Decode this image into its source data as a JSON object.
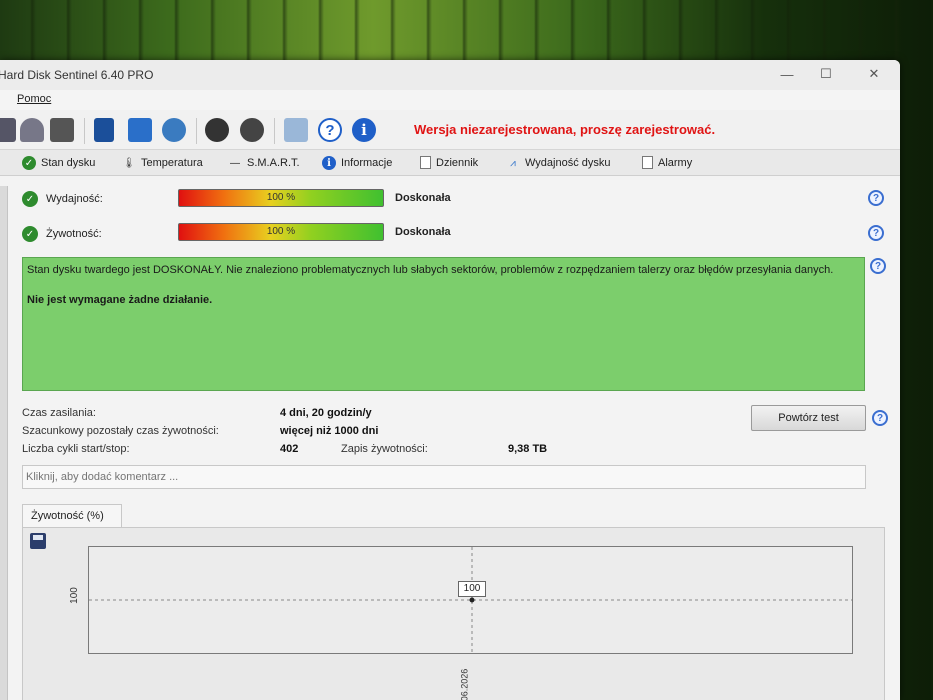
{
  "window": {
    "title": "Hard Disk Sentinel 6.40 PRO",
    "minimize": "—",
    "maximize": "☐",
    "close": "✕"
  },
  "menu": {
    "items": [
      "Pomoc"
    ]
  },
  "toolbar": {
    "unregistered_notice": "Wersja niezarejestrowana, proszę zarejestrować.",
    "icons": [
      "disk-icon",
      "report-icon",
      "print-icon",
      "book-icon",
      "email-icon",
      "network-icon",
      "settings-icon",
      "tools-icon",
      "camera-icon",
      "help-icon",
      "info-icon"
    ]
  },
  "tabs": [
    {
      "label": "Stan dysku",
      "icon": "check-circle-icon"
    },
    {
      "label": "Temperatura",
      "icon": "thermometer-icon"
    },
    {
      "label": "S.M.A.R.T.",
      "icon": "dash-icon"
    },
    {
      "label": "Informacje",
      "icon": "info-circle-icon"
    },
    {
      "label": "Dziennik",
      "icon": "document-icon"
    },
    {
      "label": "Wydajność dysku",
      "icon": "graph-icon"
    },
    {
      "label": "Alarmy",
      "icon": "alarm-document-icon"
    }
  ],
  "status": {
    "performance": {
      "label": "Wydajność:",
      "percent": 100,
      "bar_text": "100 %",
      "grade": "Doskonała"
    },
    "health": {
      "label": "Żywotność:",
      "percent": 100,
      "bar_text": "100 %",
      "grade": "Doskonała"
    },
    "message": "Stan dysku twardego jest DOSKONAŁY. Nie znaleziono problematycznych lub słabych sektorów, problemów z rozpędzaniem talerzy oraz błędów przesyłania danych.",
    "action": "Nie jest wymagane żadne działanie."
  },
  "details": {
    "power_on_label": "Czas zasilania:",
    "power_on_value": "4 dni, 20 godzin/y",
    "lifetime_label": "Szacunkowy pozostały czas żywotności:",
    "lifetime_value": "więcej niż 1000 dni",
    "cycles_label": "Liczba cykli start/stop:",
    "cycles_value": "402",
    "writes_label": "Zapis żywotności:",
    "writes_value": "9,38 TB",
    "retest_button": "Powtórz test"
  },
  "comment": {
    "placeholder": "Kliknij, aby dodać komentarz ..."
  },
  "chart_data": {
    "type": "line",
    "title": "Żywotność (%)",
    "x": [
      "06.2026"
    ],
    "values": [
      100
    ],
    "y_tick": "100",
    "point_label": "100",
    "grid": true
  },
  "colors": {
    "unregistered": "#e01414",
    "status_ok": "#7cce6c",
    "ok_icon": "#2e8b2e",
    "info_icon": "#1f5fc8"
  }
}
